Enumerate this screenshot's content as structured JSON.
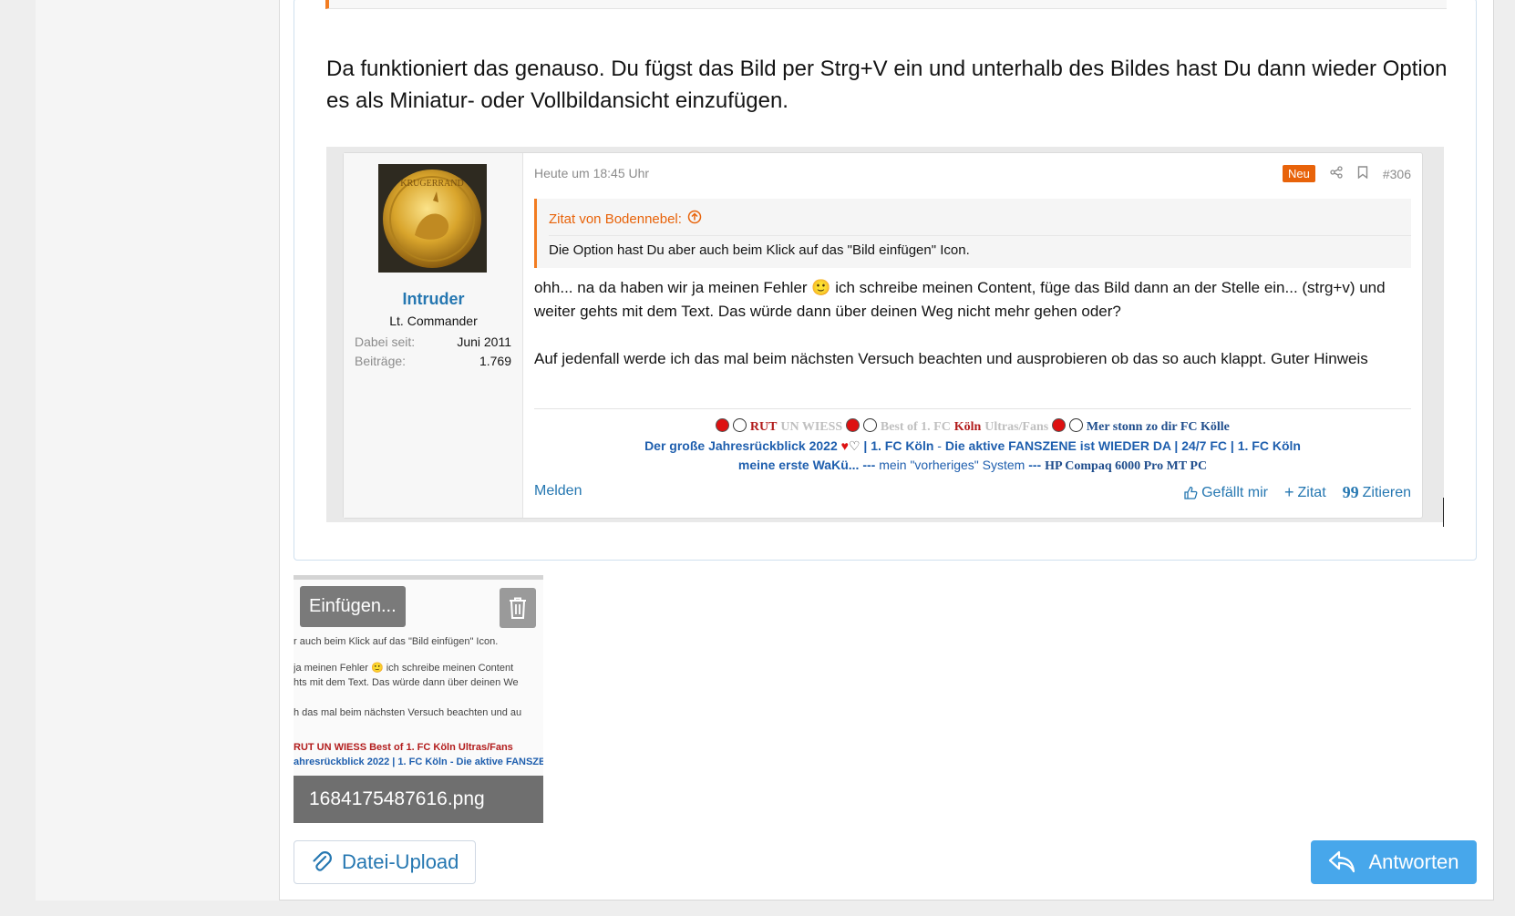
{
  "editor": {
    "text": "Da funktioniert das genauso. Du fügst das Bild per Strg+V ein und unterhalb des Bildes hast Du dann wieder Option es als Miniatur- oder Vollbildansicht einzufügen."
  },
  "embedded_post": {
    "user": {
      "name": "Intruder",
      "title": "Lt. Commander",
      "stats": [
        {
          "label": "Dabei seit:",
          "value": "Juni 2011"
        },
        {
          "label": "Beiträge:",
          "value": "1.769"
        }
      ],
      "avatar_text": "KRUGERRAND"
    },
    "date": "Heute um 18:45 Uhr",
    "badge": "Neu",
    "post_number": "#306",
    "quote": {
      "header": "Zitat von Bodennebel:",
      "text": "Die Option hast Du aber auch beim Klick auf das \"Bild einfügen\" Icon."
    },
    "body": {
      "p1": "ohh... na da haben wir ja meinen Fehler 🙂 ich schreibe meinen Content, füge das Bild dann an der Stelle ein... (strg+v) und weiter gehts mit dem Text. Das würde dann über deinen Weg nicht mehr gehen oder?",
      "p2": "Auf jedenfall werde ich das mal beim nächsten Versuch beachten und ausprobieren ob das so auch klappt. Guter Hinweis"
    },
    "signature": {
      "rut": "RUT",
      "un_wiess": "UN WIESS",
      "best_of": "Best of 1. FC",
      "koeln": "Köln",
      "ultras": "Ultras/Fans",
      "mer_stonn": "Mer stonn zo dir FC Kölle",
      "line2a": "Der große Jahresrückblick 2022",
      "line2b": "| 1. FC Köln",
      "line2sep": " - ",
      "line2c": "Die aktive FANSZENE ist WIEDER DA | 24/7 FC | 1. FC Köln",
      "line3a": "meine erste WaKü...",
      "line3sep": "---",
      "line3b": "mein \"vorheriges\" System",
      "line3sep2": "---",
      "line3c": "HP Compaq 6000 Pro MT PC"
    },
    "footer": {
      "report": "Melden",
      "like": "Gefällt mir",
      "quote_plus": "Zitat",
      "reply": "Zitieren"
    }
  },
  "attachment": {
    "insert_label": "Einfügen...",
    "filename": "1684175487616.png",
    "preview_lines": [
      "r auch beim Klick auf das \"Bild einfügen\" Icon.",
      "ja meinen Fehler 🙂 ich schreibe meinen Content",
      "hts mit dem Text. Das würde dann über deinen We",
      "h das mal beim nächsten Versuch beachten und au",
      "RUT UN WIESS Best of 1. FC Köln Ultras/Fans",
      "ahresrückblick 2022 | 1. FC Köln - Die aktive FANSZE"
    ]
  },
  "buttons": {
    "upload": "Datei-Upload",
    "reply": "Antworten"
  },
  "colors": {
    "link_blue": "#2577b1",
    "accent_orange": "#e8630a",
    "reply_button": "#47a7eb"
  }
}
